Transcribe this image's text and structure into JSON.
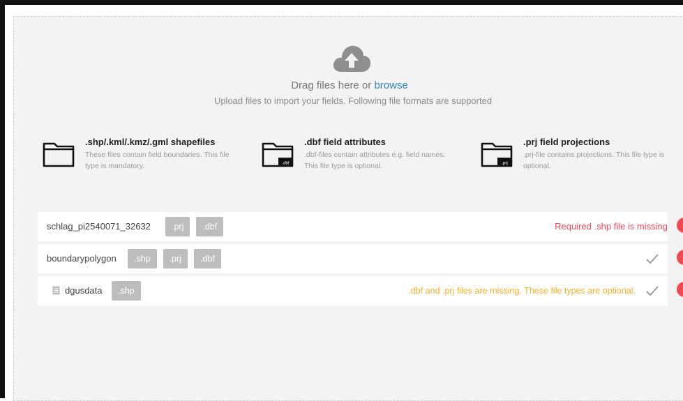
{
  "dropzone": {
    "drag_text": "Drag files here or",
    "browse_label": "browse",
    "subtitle": "Upload files to import your fields. Following file formats are supported"
  },
  "formats": [
    {
      "title": ".shp/.kml/.kmz/.gml shapefiles",
      "description": "These files contain field boundaries. This file type is mandatory.",
      "icon": "folder-icon",
      "badge": ""
    },
    {
      "title": ".dbf field attributes",
      "description": ".dbf-files contain attributes e.g. field names. This file type is optional.",
      "icon": "folder-dbf-icon",
      "badge": ".dbf"
    },
    {
      "title": ".prj field projections",
      "description": ".prj-file contains projections. This file type is optional.",
      "icon": "folder-prj-icon",
      "badge": ".prj"
    }
  ],
  "files": [
    {
      "name": "schlag_pi2540071_32632",
      "tags": [
        ".prj",
        ".dbf"
      ],
      "message": "Required .shp file is missing",
      "status": "error"
    },
    {
      "name": "boundarypolygon",
      "tags": [
        ".shp",
        ".prj",
        ".dbf"
      ],
      "message": "",
      "status": "ok"
    },
    {
      "name": "dgusdata",
      "tags": [
        ".shp"
      ],
      "message": ".dbf and .prj files are missing. These file types are optional.",
      "status": "warning"
    }
  ],
  "colors": {
    "error": "#ef4a5a",
    "warning": "#f3b128",
    "link": "#2f86c8",
    "tag_bg": "#bdbdbd",
    "remove_dot": "#ef4a52"
  }
}
